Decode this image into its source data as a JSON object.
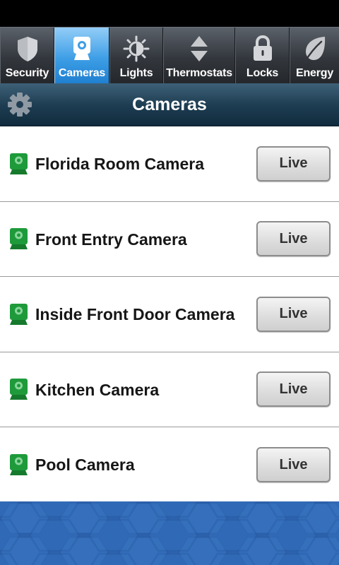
{
  "tabs": [
    {
      "label": "Security",
      "icon": "shield-icon",
      "active": false
    },
    {
      "label": "Cameras",
      "icon": "camera-icon",
      "active": true
    },
    {
      "label": "Lights",
      "icon": "light-icon",
      "active": false
    },
    {
      "label": "Thermostats",
      "icon": "thermostat-icon",
      "active": false
    },
    {
      "label": "Locks",
      "icon": "lock-icon",
      "active": false
    },
    {
      "label": "Energy",
      "icon": "leaf-icon",
      "active": false
    }
  ],
  "header": {
    "title": "Cameras",
    "settings_icon": "gear-icon"
  },
  "cameras": [
    {
      "name": "Florida Room Camera",
      "button": "Live"
    },
    {
      "name": "Front Entry Camera",
      "button": "Live"
    },
    {
      "name": "Inside Front Door Camera",
      "button": "Live"
    },
    {
      "name": "Kitchen Camera",
      "button": "Live"
    },
    {
      "name": "Pool Camera",
      "button": "Live"
    }
  ],
  "colors": {
    "active_tab": "#3d9ee6",
    "header": "#1f3e53",
    "camera_icon": "#1e9a3a",
    "footer": "#2c64b0"
  }
}
